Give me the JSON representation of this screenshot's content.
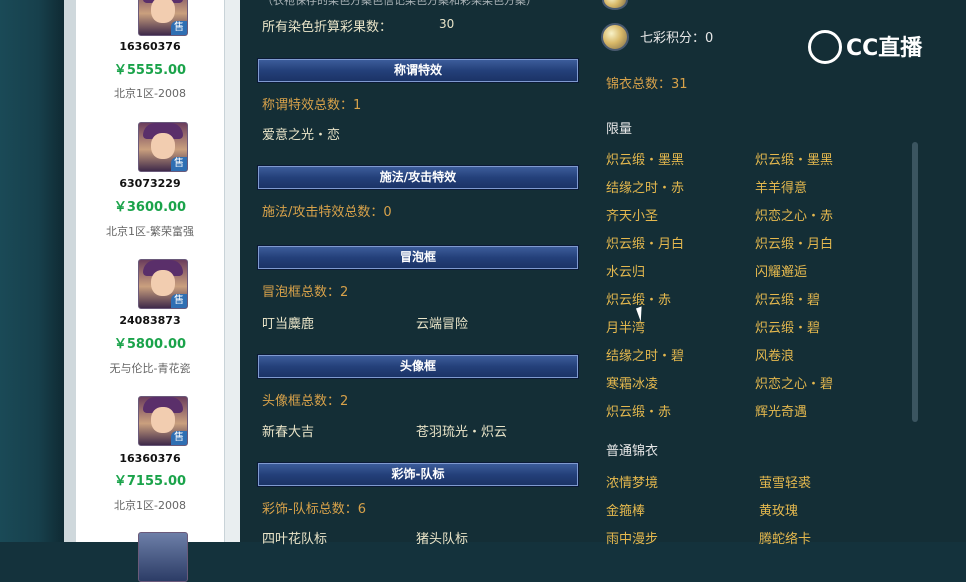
{
  "sidebar": {
    "sale_badge": "售",
    "listings": [
      {
        "id": "16360376",
        "price": "￥5555.00",
        "server": "北京1区-2008"
      },
      {
        "id": "63073229",
        "price": "￥3600.00",
        "server": "北京1区-繁荣富强"
      },
      {
        "id": "24083873",
        "price": "￥5800.00",
        "server": "无与伦比-青花瓷"
      },
      {
        "id": "16360376",
        "price": "￥7155.00",
        "server": "北京1区-2008"
      }
    ]
  },
  "main": {
    "top_cut_text": "（衣袍保存的染色方案色信记染色方案和彩果染色方案）",
    "dye_total": {
      "label": "所有染色折算彩果数：",
      "value": "30"
    },
    "sections": [
      {
        "title": "称谓特效",
        "stat": "称谓特效总数：1",
        "items": [
          "爱意之光・恋"
        ]
      },
      {
        "title": "施法/攻击特效",
        "stat": "施法/攻击特效总数：0",
        "items": []
      },
      {
        "title": "冒泡框",
        "stat": "冒泡框总数：2",
        "items": [
          "叮当麋鹿",
          "云端冒险"
        ]
      },
      {
        "title": "头像框",
        "stat": "头像框总数：2",
        "items": [
          "新春大吉",
          "苍羽琉光・炽云"
        ]
      },
      {
        "title": "彩饰-队标",
        "stat": "彩饰-队标总数：6",
        "items": [
          "四叶花队标",
          "猪头队标"
        ]
      }
    ]
  },
  "right": {
    "qicai": "七彩积分：0",
    "jinyi_total": "锦衣总数：31",
    "limited_title": "限量",
    "limited_items": [
      [
        "炽云缎・墨黑",
        "炽云缎・墨黑"
      ],
      [
        "结缘之时・赤",
        "羊羊得意"
      ],
      [
        "齐天小圣",
        "炽恋之心・赤"
      ],
      [
        "炽云缎・月白",
        "炽云缎・月白"
      ],
      [
        "水云归",
        "闪耀邂逅"
      ],
      [
        "炽云缎・赤",
        "炽云缎・碧"
      ],
      [
        "月半湾",
        "炽云缎・碧"
      ],
      [
        "结缘之时・碧",
        "风卷浪"
      ],
      [
        "寒霜冰凌",
        "炽恋之心・碧"
      ],
      [
        "炽云缎・赤",
        "辉光奇遇"
      ]
    ],
    "normal_title": "普通锦衣",
    "normal_items": [
      [
        "浓情梦境",
        "萤雪轻裘"
      ],
      [
        "金箍棒",
        "黄玫瑰"
      ],
      [
        "雨中漫步",
        "腾蛇络卡"
      ]
    ]
  },
  "watermark": {
    "text": "CC直播"
  },
  "colors": {
    "accent_green": "#1aa34a",
    "stat_orange": "#d8a24a",
    "gold_text": "#e4b84e",
    "header_blue": "#24407a"
  }
}
